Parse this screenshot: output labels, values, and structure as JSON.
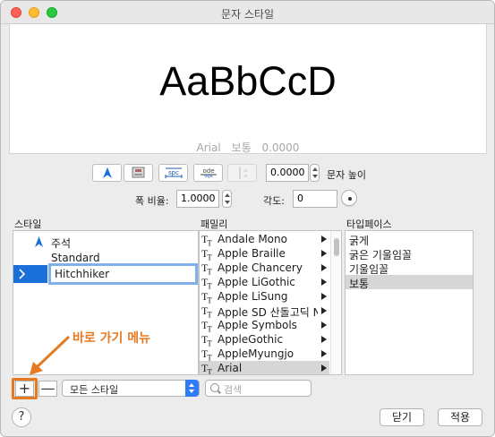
{
  "window": {
    "title": "문자 스타일"
  },
  "preview": {
    "sample": "AaBbCcD",
    "font": "Arial",
    "weight": "보통",
    "height": "0.0000"
  },
  "toolbar": {
    "text_height_value": "0.0000",
    "text_height_label": "문자 높이",
    "width_factor_label": "폭 비율:",
    "width_factor_value": "1.0000",
    "angle_label": "각도:",
    "angle_value": "0",
    "spc_label": "spc",
    "ode_label": "ode"
  },
  "columns": {
    "style": "스타일",
    "family": "패밀리",
    "typeface": "타입페이스"
  },
  "styles": [
    {
      "label": "주석",
      "annotative": true
    },
    {
      "label": "Standard",
      "annotative": false
    },
    {
      "label": "Hitchhiker",
      "annotative": false,
      "selected": true
    }
  ],
  "families": [
    "Andale Mono",
    "Apple Braille",
    "Apple Chancery",
    "Apple LiGothic",
    "Apple LiSung",
    "Apple SD 산돌고딕 N...",
    "Apple Symbols",
    "AppleGothic",
    "AppleMyungjo",
    "Arial"
  ],
  "selected_family": "Arial",
  "typefaces": [
    "굵게",
    "굵은 기울임꼴",
    "기울임꼴",
    "보통"
  ],
  "selected_typeface": "보통",
  "annotation": {
    "text": "바로 가기 메뉴",
    "color": "#e67a22"
  },
  "bottom": {
    "add_label": "+",
    "remove_label": "—",
    "filter_value": "모든 스타일",
    "search_placeholder": "검색",
    "help_label": "?",
    "close_label": "닫기",
    "apply_label": "적용"
  },
  "colors": {
    "accent": "#2f7cf6",
    "selection": "#1a6fd8",
    "annotation": "#e67a22",
    "list_selection": "#d6d6d6"
  }
}
